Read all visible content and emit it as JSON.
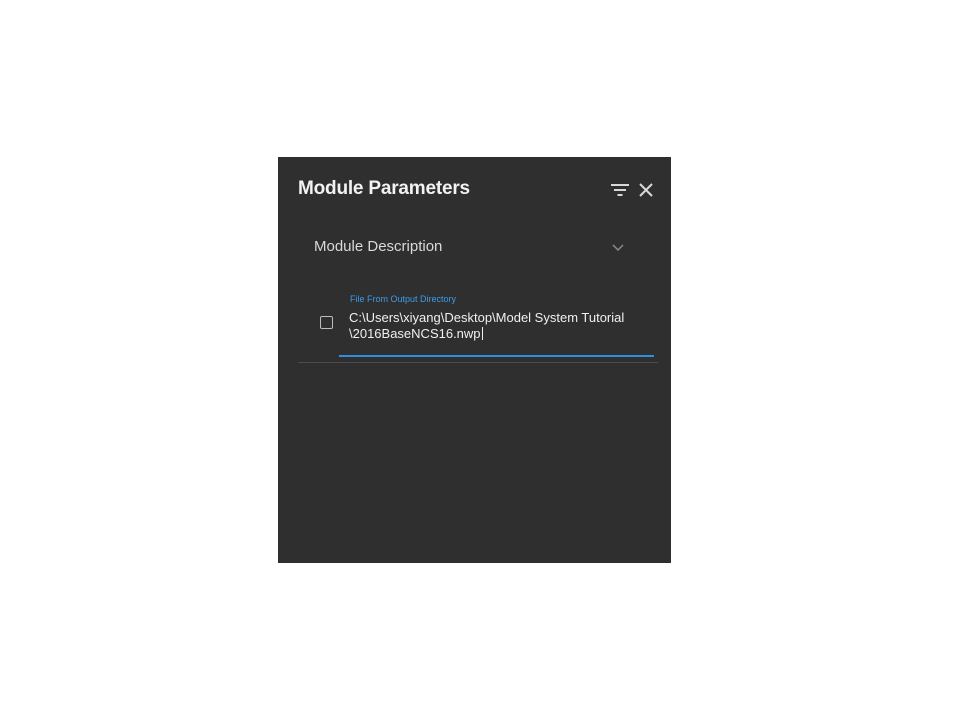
{
  "panel": {
    "title": "Module Parameters",
    "icons": {
      "filter": "filter-icon",
      "close": "close-icon"
    }
  },
  "description": {
    "label": "Module Description",
    "icon": "chevron-down-icon"
  },
  "parameter": {
    "label": "File From Output Directory",
    "value": "C:\\Users\\xiyang\\Desktop\\Model System Tutorial\n\\2016BaseNCS16.nwp",
    "checked": false
  },
  "colors": {
    "panel_background": "#2f2f2f",
    "accent": "#2f8fdb",
    "text": "#f2f2f2"
  }
}
